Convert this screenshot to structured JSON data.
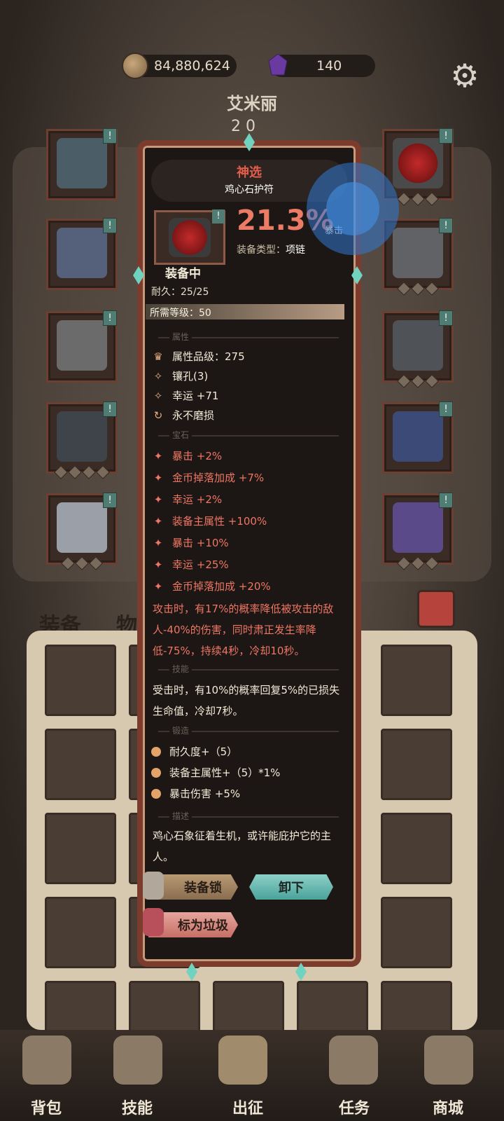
{
  "top": {
    "gold": "84,880,624",
    "gems": "140",
    "hero_name": "艾米丽",
    "hero_level_peek": "2  0"
  },
  "tabs": {
    "equipment": "装备",
    "items": "物品"
  },
  "nav": {
    "bag": "背包",
    "skills": "技能",
    "expedition": "出征",
    "quests": "任务",
    "shop": "商城"
  },
  "item": {
    "rarity": "神选",
    "name": "鸡心石护符",
    "main_value": "21.3%",
    "main_stat": "暴击",
    "type_label": "装备类型：",
    "type_value": "项链",
    "equipped": "装备中",
    "durability": "耐久：25/25",
    "required_level": "所需等级：50",
    "section_attributes": "属性",
    "attributes": [
      "属性品级：275",
      "镶孔(3)",
      "幸运 +71",
      "永不磨损"
    ],
    "section_gems": "宝石",
    "gems": [
      "暴击 +2%",
      "金币掉落加成 +7%",
      "幸运 +2%",
      "装备主属性 +100%",
      "暴击 +10%",
      "幸运 +25%",
      "金币掉落加成 +20%"
    ],
    "gem_effect": "攻击时，有17%的概率降低被攻击的敌人-40%的伤害，同时肃正发生率降低-75%，持续4秒，冷却10秒。",
    "section_skill": "技能",
    "skill_text": "受击时，有10%的概率回复5%的已损失生命值，冷却7秒。",
    "section_forge": "锻造",
    "forge": [
      "耐久度+（5）",
      "装备主属性+（5）*1%",
      "暴击伤害 +5%"
    ],
    "section_desc": "描述",
    "description": "鸡心石象征着生机，或许能庇护它的主人。",
    "btn_lock": "装备锁",
    "btn_unequip": "卸下",
    "btn_trash": "标为垃圾"
  },
  "colors": {
    "rarity": "#e35d4b",
    "gem_text": "#ee7664",
    "main_value": "#ec7b66",
    "unequip_btn": "#6fc3b8"
  }
}
